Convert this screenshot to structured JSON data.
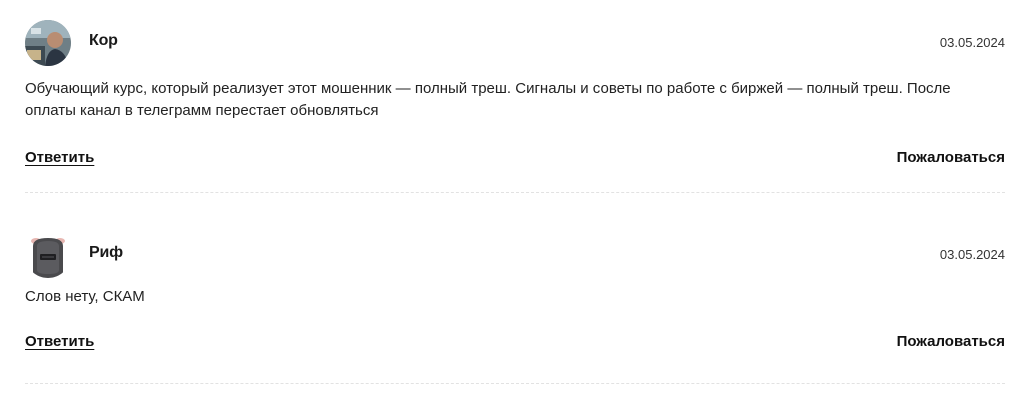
{
  "comments": [
    {
      "author": "Кор",
      "date": "03.05.2024",
      "text": "Обучающий курс, который реализует этот мошенник — полный треш. Сигналы и советы по работе с биржей — полный треш. После оплаты канал в телеграмм перестает обновляться",
      "reply_label": "Ответить",
      "complain_label": "Пожаловаться",
      "avatar_icon": "user-photo-avatar"
    },
    {
      "author": "Риф",
      "date": "03.05.2024",
      "text": "Слов нету, СКАМ",
      "reply_label": "Ответить",
      "complain_label": "Пожаловаться",
      "avatar_icon": "helmet-avatar"
    }
  ]
}
